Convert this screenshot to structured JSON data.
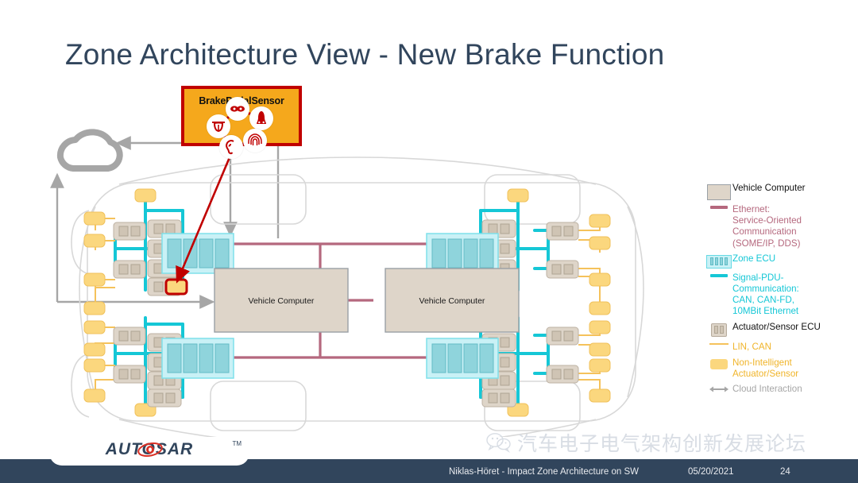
{
  "title": "Zone Architecture View - New Brake Function",
  "callout": {
    "label": "BrakePedalSensor",
    "border_color": "#C00000",
    "fill_color": "#F5A81C",
    "organs": [
      {
        "name": "eyes-icon"
      },
      {
        "name": "nose-icon"
      },
      {
        "name": "fingerprint-icon"
      },
      {
        "name": "ear-icon"
      },
      {
        "name": "tongue-icon"
      }
    ]
  },
  "diagram": {
    "vehicle_computers": [
      {
        "label": "Vehicle Computer"
      },
      {
        "label": "Vehicle Computer"
      }
    ],
    "zone_ecu_count": 4,
    "colors": {
      "vehicle_computer_fill": "#DED5C9",
      "vehicle_computer_border": "#9AA0A6",
      "ethernet": "#B5687E",
      "signal_pdu": "#15C7D6",
      "lin_can": "#F5C25B",
      "zone_ecu_fill": "#C9F1F6",
      "zone_ecu_inner": "#8FD4DC",
      "actuator_sensor_ecu": "#DED5C9",
      "non_intelligent": "#FBD77E",
      "cloud": "#A6A6A6",
      "highlight": "#C00000",
      "vehicle_outline": "#D8D8D8"
    }
  },
  "legend": {
    "items": [
      {
        "key": "vehicle-computer-swatch",
        "label": "Vehicle Computer",
        "color": "#111111"
      },
      {
        "key": "ethernet-line-swatch",
        "label": "Ethernet:\nService-Oriented\nCommunication\n(SOME/IP, DDS)",
        "color": "#B5687E"
      },
      {
        "key": "zone-ecu-swatch",
        "label": "Zone ECU",
        "color": "#15C7D6"
      },
      {
        "key": "signal-pdu-line-swatch",
        "label": "Signal-PDU-\nCommunication:\nCAN, CAN-FD,\n10MBit Ethernet",
        "color": "#15C7D6"
      },
      {
        "key": "actuator-sensor-ecu-swatch",
        "label": "Actuator/Sensor ECU",
        "color": "#111111"
      },
      {
        "key": "lin-can-line-swatch",
        "label": "LIN, CAN",
        "color": "#F0B429"
      },
      {
        "key": "non-intelligent-swatch",
        "label": "Non-Intelligent\nActuator/Sensor",
        "color": "#F0B429"
      },
      {
        "key": "cloud-interaction-swatch",
        "label": "Cloud Interaction",
        "color": "#A6A6A6"
      }
    ]
  },
  "footer": {
    "logo_word": "AUTOSAR",
    "logo_tm": "TM",
    "text": "Niklas-Höret - Impact Zone Architecture on SW",
    "date": "05/20/2021",
    "page": "24",
    "bar_color": "#31455C"
  },
  "watermark": {
    "text": "汽车电子电气架构创新发展论坛",
    "icon": "wechat-icon"
  }
}
